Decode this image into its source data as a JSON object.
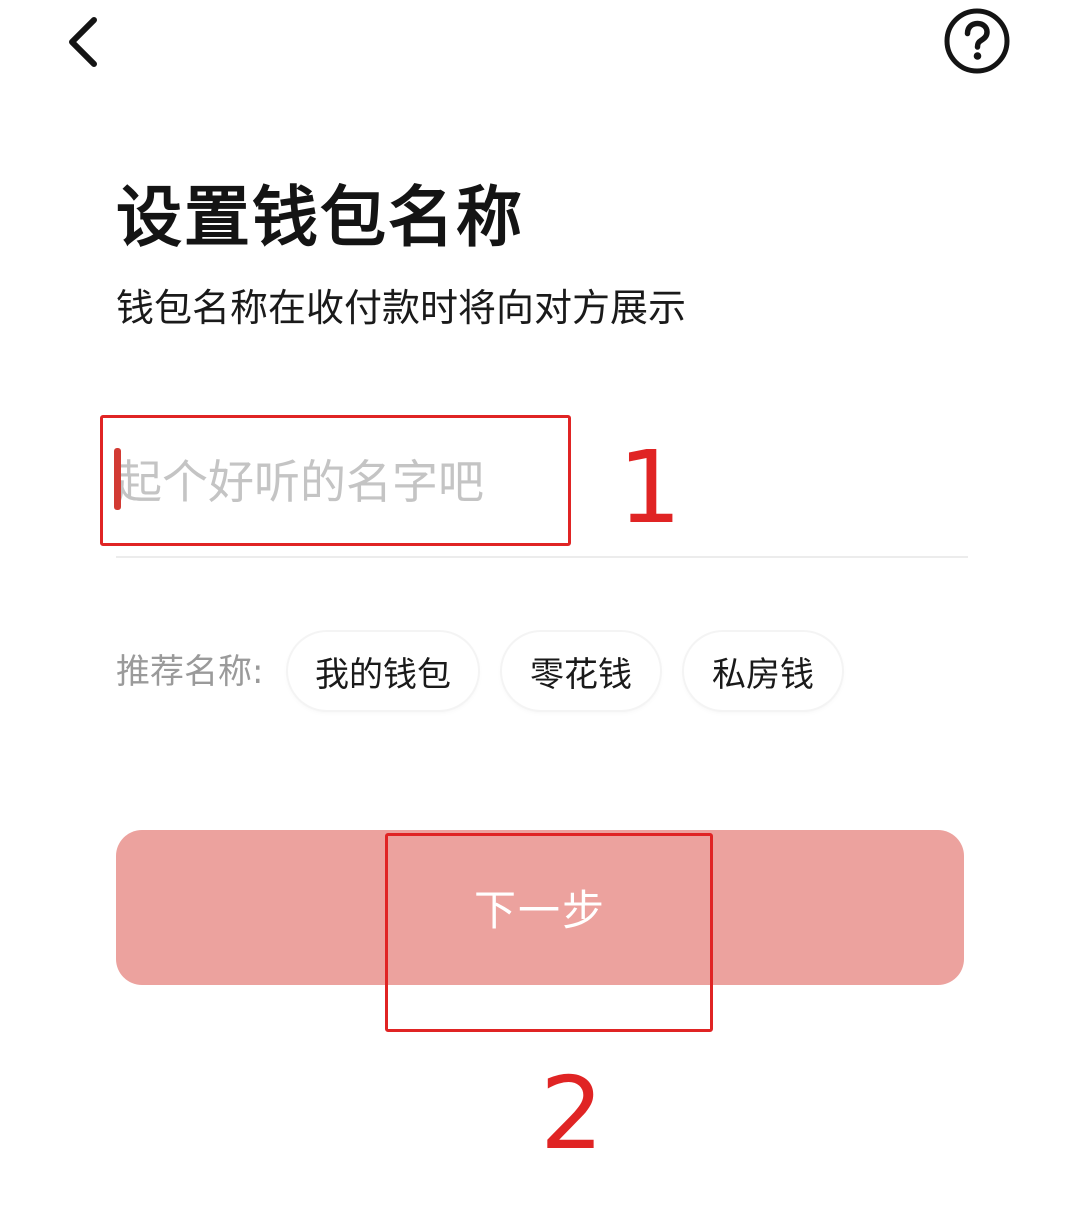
{
  "header": {
    "back_icon": "chevron-left-icon",
    "help_icon": "question-circle-icon"
  },
  "main": {
    "title": "设置钱包名称",
    "subtitle": "钱包名称在收付款时将向对方展示",
    "name_input": {
      "placeholder": "起个好听的名字吧",
      "value": ""
    },
    "suggestions": {
      "label": "推荐名称:",
      "chips": [
        "我的钱包",
        "零花钱",
        "私房钱"
      ]
    },
    "next_button_label": "下一步"
  },
  "annotations": {
    "marker_1": "1",
    "marker_2": "2",
    "color": "#e02424"
  },
  "colors": {
    "accent": "#d23a33",
    "button_disabled_bg": "#eca29e",
    "text_primary": "#141414",
    "text_secondary": "#9a9a9a",
    "placeholder": "#c4c4c4"
  }
}
